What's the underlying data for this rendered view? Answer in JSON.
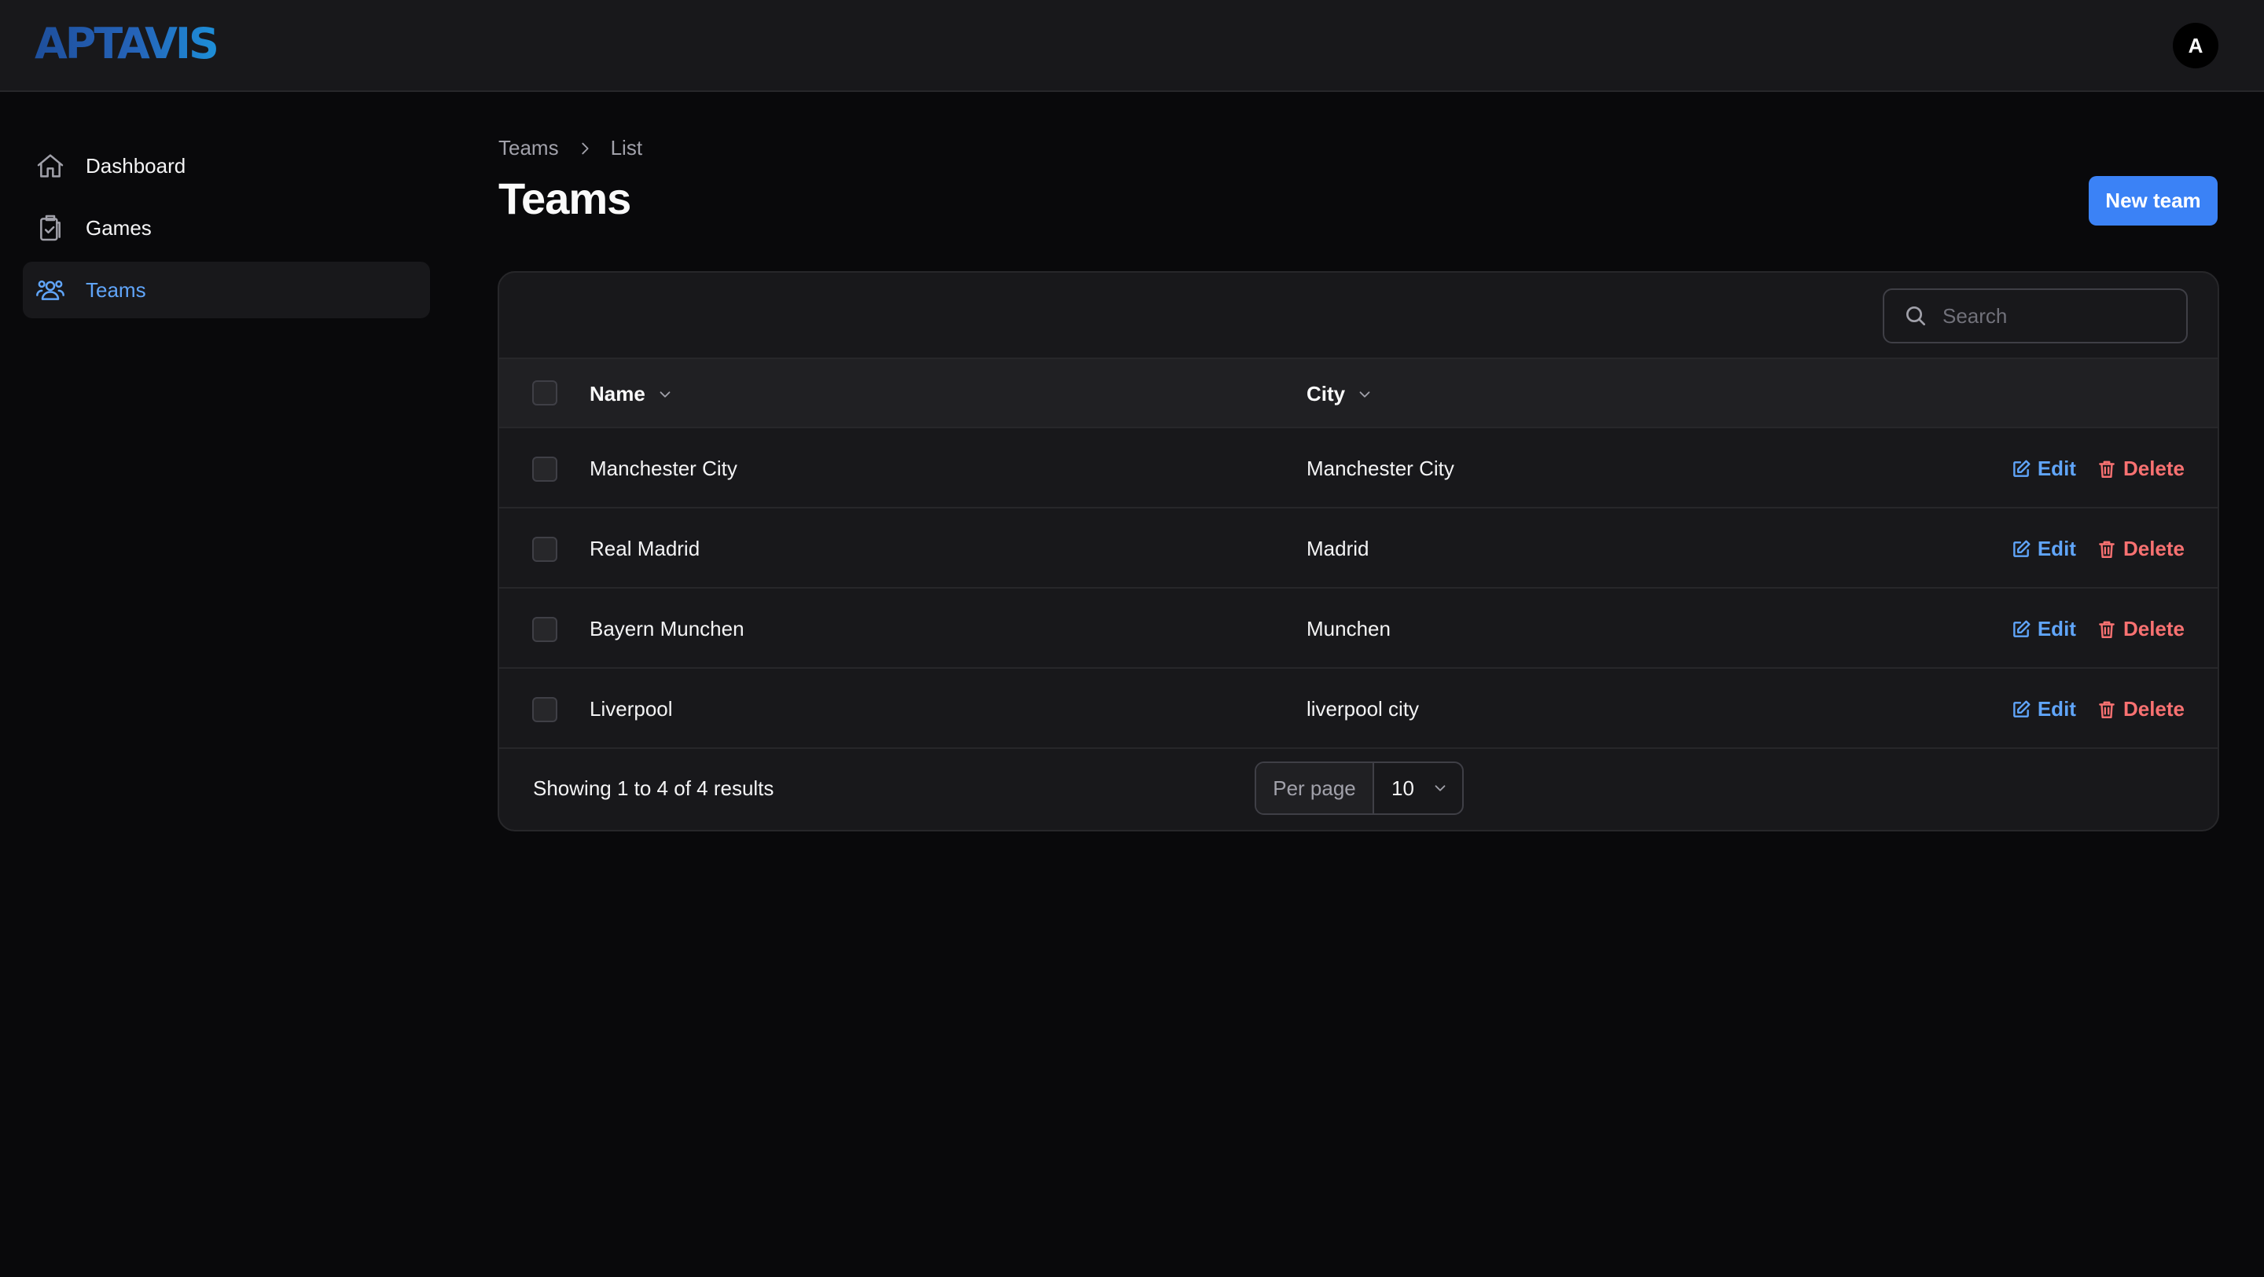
{
  "app": {
    "logo_text": "APTAVIS",
    "avatar_initial": "A"
  },
  "sidebar": {
    "items": [
      {
        "label": "Dashboard",
        "icon": "home-icon",
        "active": false
      },
      {
        "label": "Games",
        "icon": "clipboard-check-icon",
        "active": false
      },
      {
        "label": "Teams",
        "icon": "users-icon",
        "active": true
      }
    ]
  },
  "breadcrumb": {
    "items": [
      "Teams",
      "List"
    ]
  },
  "page": {
    "title": "Teams",
    "new_button_label": "New team"
  },
  "search": {
    "placeholder": "Search",
    "value": ""
  },
  "table": {
    "columns": [
      "Name",
      "City"
    ],
    "rows": [
      {
        "name": "Manchester City",
        "city": "Manchester City"
      },
      {
        "name": "Real Madrid",
        "city": "Madrid"
      },
      {
        "name": "Bayern Munchen",
        "city": "Munchen"
      },
      {
        "name": "Liverpool",
        "city": "liverpool city"
      }
    ],
    "edit_label": "Edit",
    "delete_label": "Delete"
  },
  "pagination": {
    "summary": "Showing 1 to 4 of 4 results",
    "per_page_label": "Per page",
    "per_page_value": "10"
  },
  "colors": {
    "accent": "#3b82f6",
    "link": "#60a5fa",
    "danger": "#f87171",
    "background": "#09090b",
    "surface": "#18181b"
  }
}
